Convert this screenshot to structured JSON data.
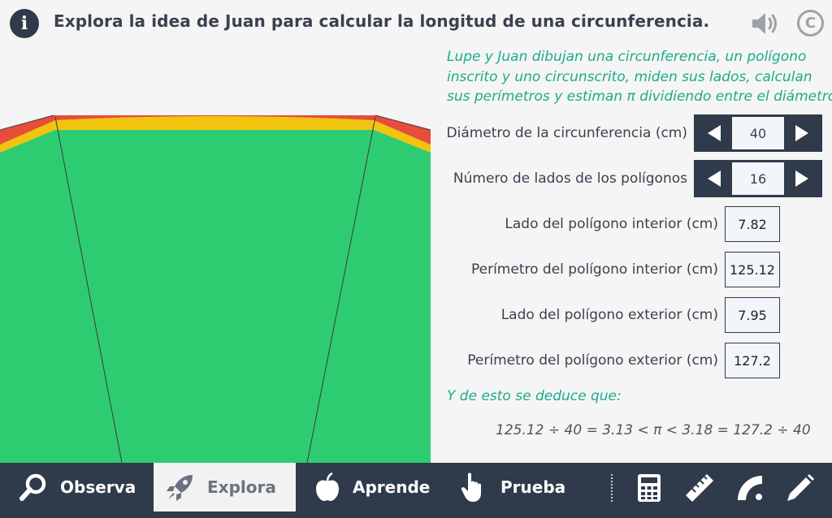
{
  "header": {
    "info_icon": "info-icon",
    "info_glyph": "i",
    "title": "Explora la idea de Juan para calcular la longitud de una circunferencia.",
    "sound_icon": "speaker-icon",
    "copyright_glyph": "C"
  },
  "colors": {
    "dark": "#2f3a4b",
    "accent": "#1eaa8c",
    "green_inner": "#2ecc71",
    "yellow_circle": "#f1c40f",
    "red_outer": "#e74c3c"
  },
  "panel": {
    "intro": [
      "Lupe y Juan dibujan una circunferencia, un polígono",
      "inscrito y uno circunscrito, miden sus lados, calculan",
      "sus perímetros y estiman π dividiendo entre el diámetro."
    ],
    "diameter_label": "Diámetro de la circunferencia (cm)",
    "diameter_value": "40",
    "sides_label": "Número de lados de los polígonos",
    "sides_value": "16",
    "inner_side_label": "Lado del polígono interior (cm)",
    "inner_side_value": "7.82",
    "inner_perimeter_label": "Perímetro del polígono interior (cm)",
    "inner_perimeter_value": "125.12",
    "outer_side_label": "Lado del polígono exterior (cm)",
    "outer_side_value": "7.95",
    "outer_perimeter_label": "Perímetro del polígono exterior (cm)",
    "outer_perimeter_value": "127.2",
    "deduce": "Y de esto se deduce que:",
    "formula": "125.12 ÷ 40 = 3.13 < π < 3.18 = 127.2 ÷ 40"
  },
  "nav": {
    "items": [
      {
        "label": "Observa",
        "icon": "magnifier-icon"
      },
      {
        "label": "Explora",
        "icon": "rocket-icon",
        "active": true
      },
      {
        "label": "Aprende",
        "icon": "apple-icon"
      },
      {
        "label": "Prueba",
        "icon": "hand-pointer-icon"
      }
    ],
    "tools": [
      "calculator-icon",
      "ruler-icon",
      "protractor-icon",
      "pencil-icon"
    ]
  }
}
